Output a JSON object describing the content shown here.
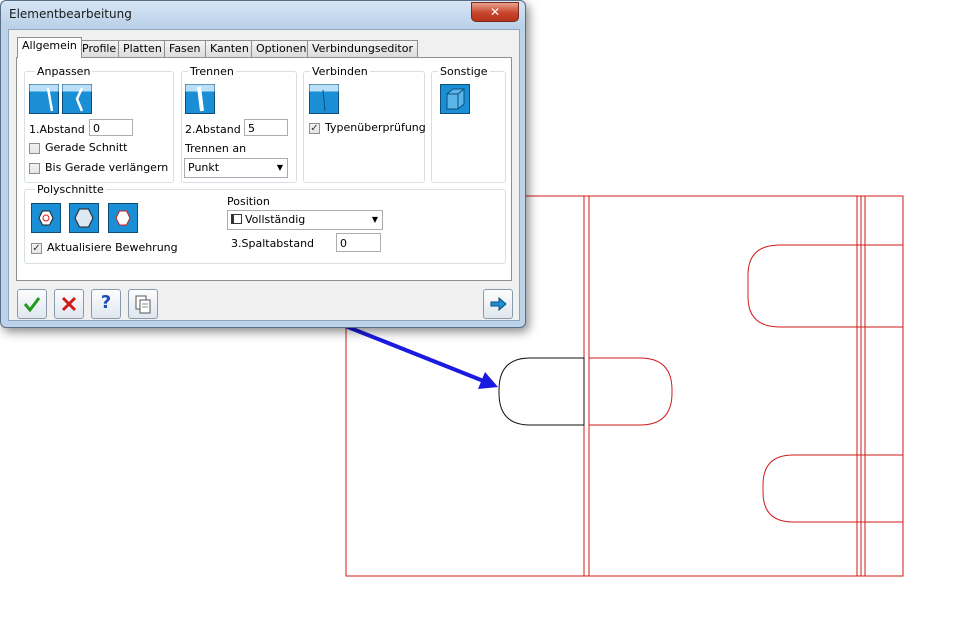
{
  "window": {
    "title": "Elementbearbeitung",
    "close_glyph": "✕"
  },
  "tabs": [
    "Allgemein",
    "Profile",
    "Platten",
    "Fasen",
    "Kanten",
    "Optionen",
    "Verbindungseditor"
  ],
  "groups": {
    "anpassen": {
      "label": "Anpassen",
      "abstand_label": "1.Abstand",
      "abstand_value": "0",
      "gerade_schnitt": "Gerade Schnitt",
      "gerade_schnitt_checked": false,
      "bis_gerade": "Bis Gerade verlängern",
      "bis_gerade_checked": false
    },
    "trennen": {
      "label": "Trennen",
      "abstand_label": "2.Abstand",
      "abstand_value": "5",
      "trennen_an_label": "Trennen an",
      "trennen_an_value": "Punkt"
    },
    "verbinden": {
      "label": "Verbinden",
      "typen_label": "Typenüberprüfung",
      "typen_checked": true
    },
    "sonstige": {
      "label": "Sonstige"
    },
    "polyschnitte": {
      "label": "Polyschnitte",
      "aktualisiere": "Aktualisiere Bewehrung",
      "aktualisiere_checked": true,
      "position_label": "Position",
      "position_value": "Vollständig",
      "spalt_label": "3.Spaltabstand",
      "spalt_value": "0"
    }
  },
  "check_glyph": "✓",
  "buttons": {
    "help_glyph": "?"
  },
  "colors": {
    "accent_blue": "#1b8fd6",
    "cad_red": "#d11a1a",
    "arrow_blue": "#1a1ae0"
  }
}
